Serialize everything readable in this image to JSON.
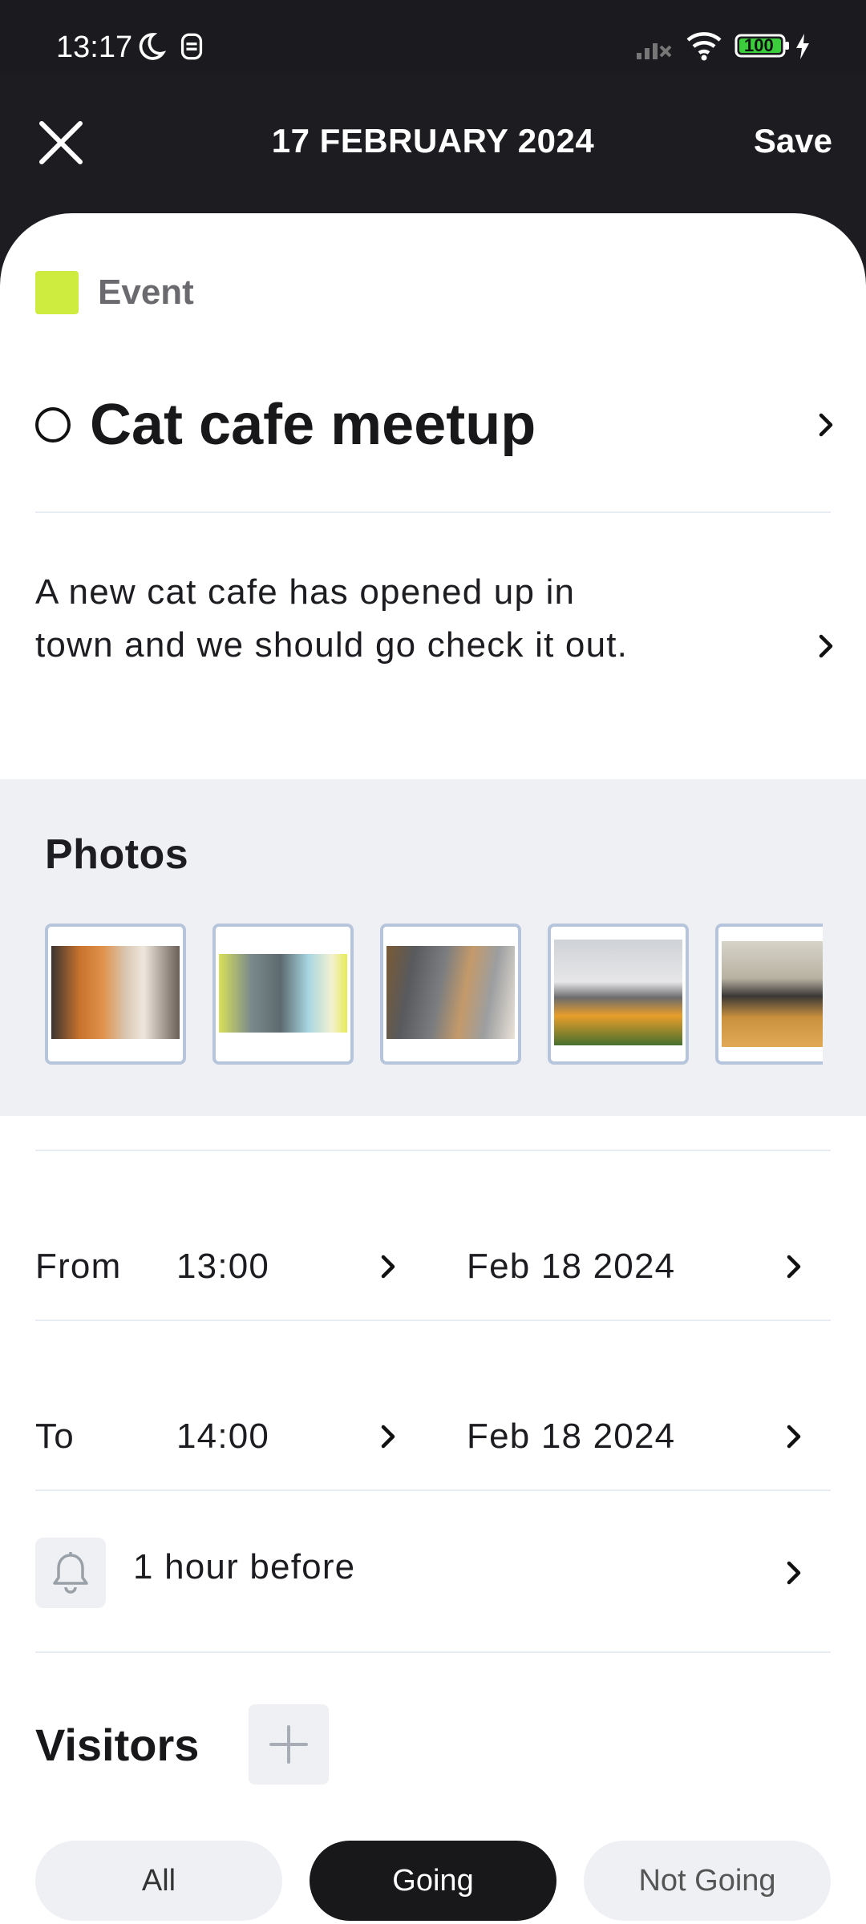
{
  "status_bar": {
    "time": "13:17",
    "battery": "100",
    "icons": [
      "moon-icon",
      "notification-icon",
      "signal-icon",
      "wifi-icon",
      "battery-icon",
      "charging-icon"
    ]
  },
  "header": {
    "title": "17 FEBRUARY 2024",
    "save_label": "Save",
    "close_icon": "close-icon"
  },
  "event": {
    "type_label": "Event",
    "type_color": "#cdec3f",
    "title": "Cat cafe meetup",
    "description": "A new cat cafe has opened up in town and we should go check it out."
  },
  "photos": {
    "heading": "Photos",
    "items": [
      "cat-photo-1",
      "cat-photo-2",
      "cat-photo-3",
      "cat-photo-4",
      "cat-photo-5"
    ]
  },
  "schedule": {
    "from_label": "From",
    "from_time": "13:00",
    "from_date": "Feb 18 2024",
    "to_label": "To",
    "to_time": "14:00",
    "to_date": "Feb 18 2024"
  },
  "reminder": {
    "label": "1 hour before",
    "icon": "bell-icon"
  },
  "visitors": {
    "heading": "Visitors",
    "filters": [
      "All",
      "Going",
      "Not Going"
    ],
    "selected": "Going"
  }
}
